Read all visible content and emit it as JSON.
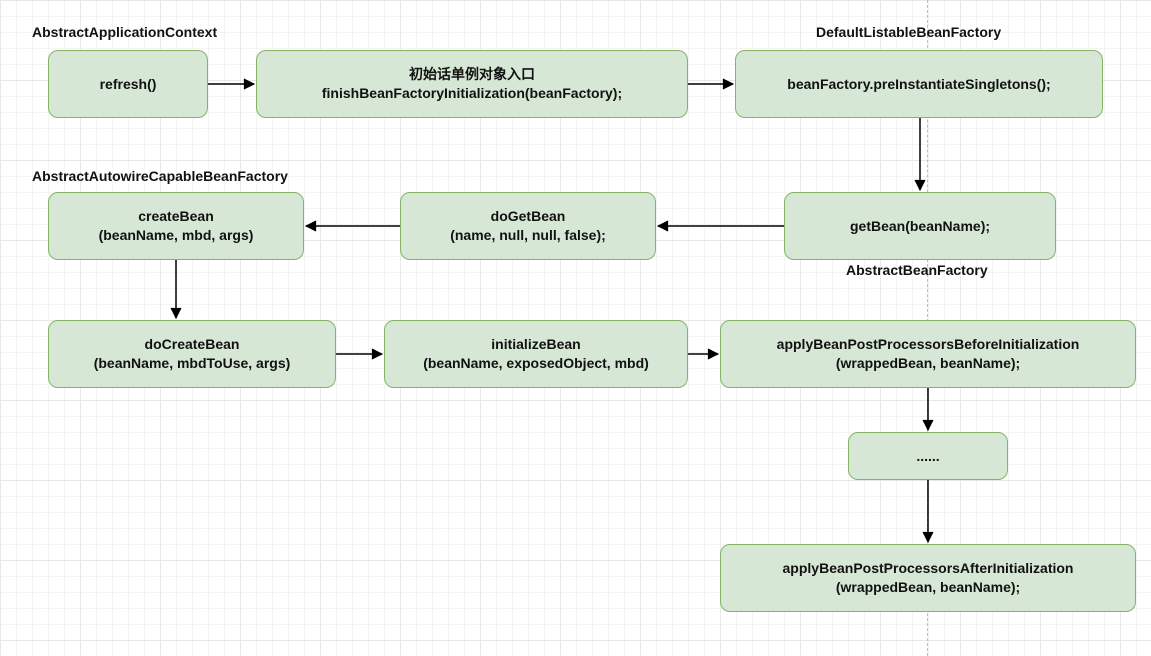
{
  "labels": {
    "abstractApplicationContext": "AbstractApplicationContext",
    "defaultListableBeanFactory": "DefaultListableBeanFactory",
    "abstractAutowireCapableBeanFactory": "AbstractAutowireCapableBeanFactory",
    "abstractBeanFactory": "AbstractBeanFactory"
  },
  "nodes": {
    "refresh": {
      "line1": "refresh()"
    },
    "finishBeanFactoryInit": {
      "line1": "初始话单例对象入口",
      "line2": "finishBeanFactoryInitialization(beanFactory);"
    },
    "preInstantiate": {
      "line1": "beanFactory.preInstantiateSingletons();"
    },
    "getBean": {
      "line1": "getBean(beanName);"
    },
    "doGetBean": {
      "line1": "doGetBean",
      "line2": "(name, null, null, false);"
    },
    "createBean": {
      "line1": "createBean",
      "line2": "(beanName, mbd, args)"
    },
    "doCreateBean": {
      "line1": "doCreateBean",
      "line2": "(beanName, mbdToUse, args)"
    },
    "initializeBean": {
      "line1": "initializeBean",
      "line2": "(beanName, exposedObject, mbd)"
    },
    "applyBefore": {
      "line1": "applyBeanPostProcessorsBeforeInitialization",
      "line2": "(wrappedBean, beanName);"
    },
    "ellipsis": {
      "line1": "......"
    },
    "applyAfter": {
      "line1": "applyBeanPostProcessorsAfterInitialization",
      "line2": "(wrappedBean, beanName);"
    }
  }
}
